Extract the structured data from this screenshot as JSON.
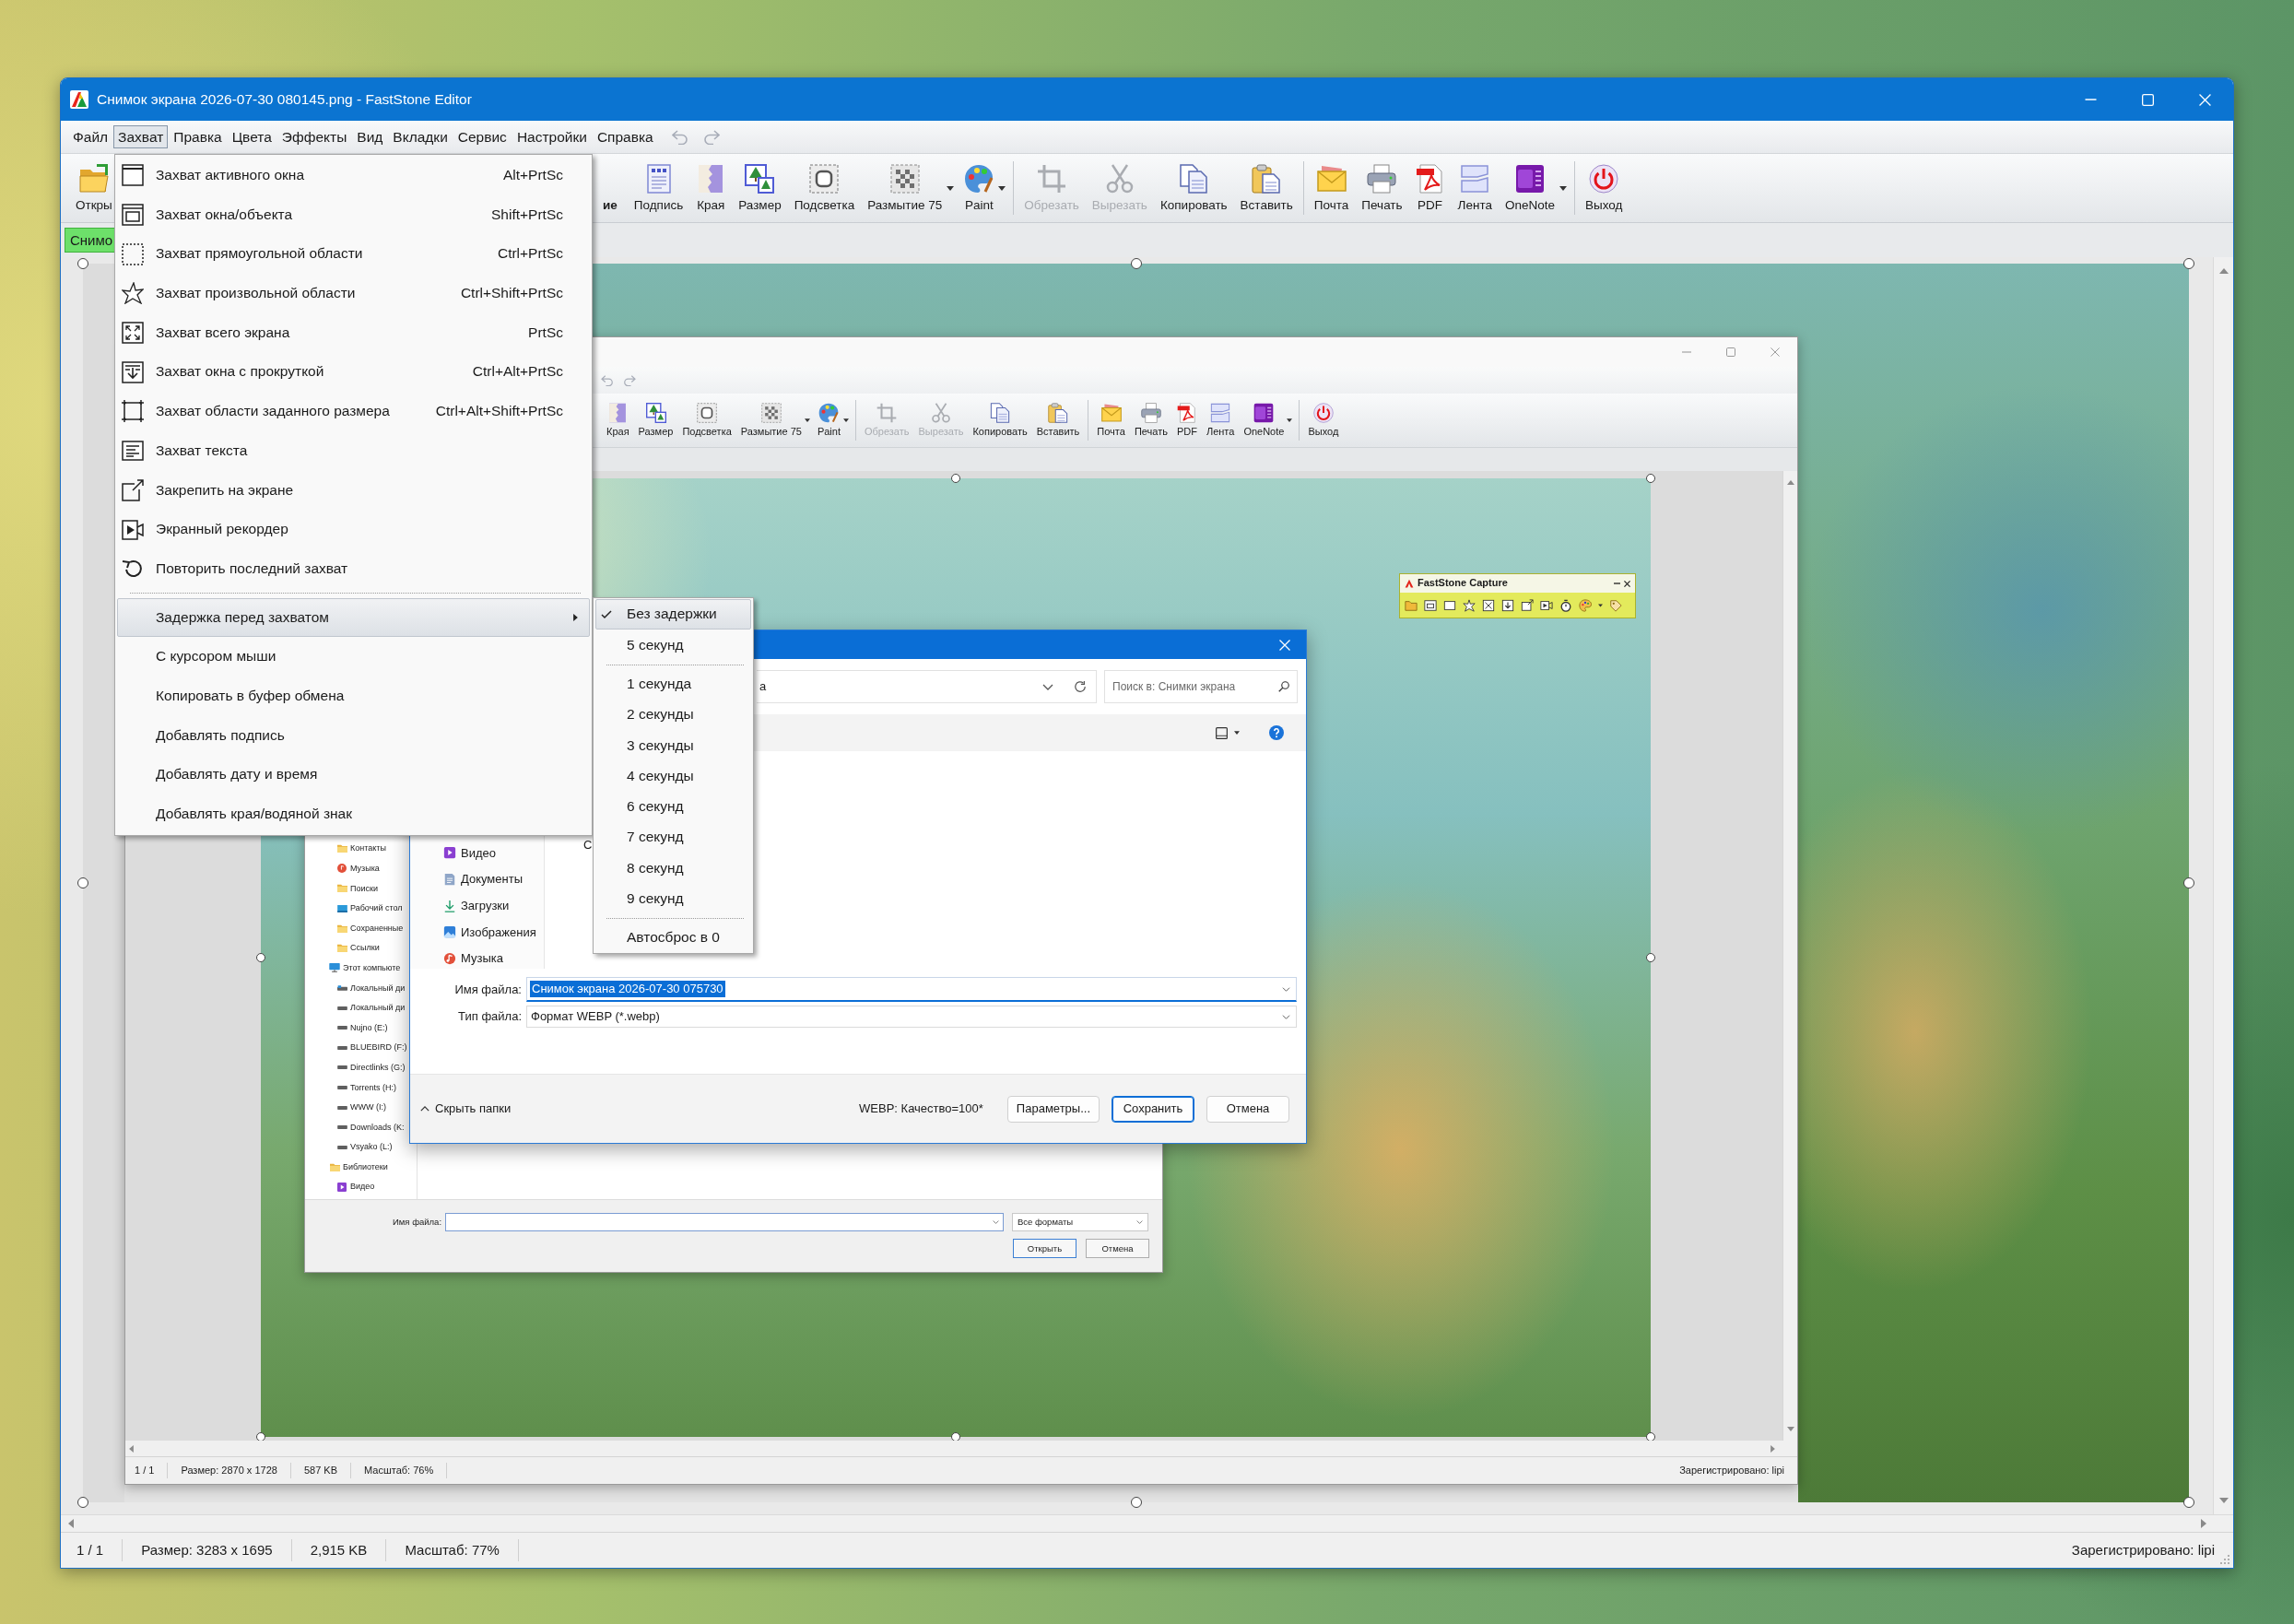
{
  "window": {
    "title": "Снимок экрана 2026-07-30 080145.png - FastStone Editor"
  },
  "menu_bar": [
    {
      "label": "Файл",
      "selected": false
    },
    {
      "label": "Захват",
      "selected": true
    },
    {
      "label": "Правка",
      "selected": false
    },
    {
      "label": "Цвета",
      "selected": false
    },
    {
      "label": "Эффекты",
      "selected": false
    },
    {
      "label": "Вид",
      "selected": false
    },
    {
      "label": "Вкладки",
      "selected": false
    },
    {
      "label": "Сервис",
      "selected": false
    },
    {
      "label": "Настройки",
      "selected": false
    },
    {
      "label": "Справка",
      "selected": false
    }
  ],
  "toolbar": [
    {
      "kind": "button",
      "label": "Откры",
      "disabled": false,
      "dropdown": false
    },
    {
      "kind": "partial",
      "label": "ие",
      "disabled": false,
      "dropdown": false
    },
    {
      "kind": "button",
      "label": "Подпись",
      "disabled": false,
      "dropdown": false
    },
    {
      "kind": "button",
      "label": "Края",
      "disabled": false,
      "dropdown": false
    },
    {
      "kind": "button",
      "label": "Размер",
      "disabled": false,
      "dropdown": false
    },
    {
      "kind": "button",
      "label": "Подсветка",
      "disabled": false,
      "dropdown": false
    },
    {
      "kind": "button",
      "label": "Размытие 75",
      "disabled": false,
      "dropdown": true
    },
    {
      "kind": "button",
      "label": "Paint",
      "disabled": false,
      "dropdown": true
    },
    {
      "kind": "separator"
    },
    {
      "kind": "button",
      "label": "Обрезать",
      "disabled": true,
      "dropdown": false
    },
    {
      "kind": "button",
      "label": "Вырезать",
      "disabled": true,
      "dropdown": false
    },
    {
      "kind": "button",
      "label": "Копировать",
      "disabled": false,
      "dropdown": false
    },
    {
      "kind": "button",
      "label": "Вставить",
      "disabled": false,
      "dropdown": false
    },
    {
      "kind": "separator"
    },
    {
      "kind": "button",
      "label": "Почта",
      "disabled": false,
      "dropdown": false
    },
    {
      "kind": "button",
      "label": "Печать",
      "disabled": false,
      "dropdown": false
    },
    {
      "kind": "button",
      "label": "PDF",
      "disabled": false,
      "dropdown": false
    },
    {
      "kind": "button",
      "label": "Лента",
      "disabled": false,
      "dropdown": false
    },
    {
      "kind": "button",
      "label": "OneNote",
      "disabled": false,
      "dropdown": true
    },
    {
      "kind": "separator"
    },
    {
      "kind": "button",
      "label": "Выход",
      "disabled": false,
      "dropdown": false
    }
  ],
  "tabs": [
    {
      "label": "Снимо",
      "selected": true
    }
  ],
  "capture_menu": [
    {
      "kind": "item",
      "label": "Захват активного окна",
      "shortcut": "Alt+PrtSc",
      "highlighted": false
    },
    {
      "kind": "item",
      "label": "Захват окна/объекта",
      "shortcut": "Shift+PrtSc",
      "highlighted": false
    },
    {
      "kind": "item",
      "label": "Захват прямоугольной области",
      "shortcut": "Ctrl+PrtSc",
      "highlighted": false
    },
    {
      "kind": "item",
      "label": "Захват произвольной области",
      "shortcut": "Ctrl+Shift+PrtSc",
      "highlighted": false
    },
    {
      "kind": "item",
      "label": "Захват всего экрана",
      "shortcut": "PrtSc",
      "highlighted": false
    },
    {
      "kind": "item",
      "label": "Захват окна с прокруткой",
      "shortcut": "Ctrl+Alt+PrtSc",
      "highlighted": false
    },
    {
      "kind": "item",
      "label": "Захват области заданного размера",
      "shortcut": "Ctrl+Alt+Shift+PrtSc",
      "highlighted": false
    },
    {
      "kind": "item",
      "label": "Захват текста",
      "highlighted": false
    },
    {
      "kind": "item",
      "label": "Закрепить на экране",
      "highlighted": false
    },
    {
      "kind": "item",
      "label": "Экранный рекордер",
      "highlighted": false
    },
    {
      "kind": "item",
      "label": "Повторить последний захват",
      "highlighted": false
    },
    {
      "kind": "separator"
    },
    {
      "kind": "submenu",
      "label": "Задержка перед захватом",
      "highlighted": true
    },
    {
      "kind": "item",
      "label": "С курсором мыши",
      "highlighted": false
    },
    {
      "kind": "item",
      "label": "Копировать в буфер обмена",
      "highlighted": false
    },
    {
      "kind": "item",
      "label": "Добавлять подпись",
      "highlighted": false
    },
    {
      "kind": "item",
      "label": "Добавлять дату и время",
      "highlighted": false
    },
    {
      "kind": "item",
      "label": "Добавлять края/водяной знак",
      "highlighted": false
    }
  ],
  "delay_submenu": [
    {
      "kind": "item",
      "label": "Без задержки",
      "checked": true,
      "highlighted": true
    },
    {
      "kind": "item",
      "label": "5 секунд",
      "checked": false,
      "highlighted": false
    },
    {
      "kind": "separator"
    },
    {
      "kind": "item",
      "label": "1 секунда",
      "checked": false,
      "highlighted": false
    },
    {
      "kind": "item",
      "label": "2 секунды",
      "checked": false,
      "highlighted": false
    },
    {
      "kind": "item",
      "label": "3 секунды",
      "checked": false,
      "highlighted": false
    },
    {
      "kind": "item",
      "label": "4 секунды",
      "checked": false,
      "highlighted": false
    },
    {
      "kind": "item",
      "label": "6 секунд",
      "checked": false,
      "highlighted": false
    },
    {
      "kind": "item",
      "label": "7 секунд",
      "checked": false,
      "highlighted": false
    },
    {
      "kind": "item",
      "label": "8 секунд",
      "checked": false,
      "highlighted": false
    },
    {
      "kind": "item",
      "label": "9 секунд",
      "checked": false,
      "highlighted": false
    },
    {
      "kind": "separator"
    },
    {
      "kind": "item",
      "label": "Автосброс в 0",
      "checked": false,
      "highlighted": false
    }
  ],
  "canvas": {
    "inner_window": {
      "toolbar": [
        {
          "kind": "button",
          "label": "Края",
          "disabled": false,
          "dropdown": false
        },
        {
          "kind": "button",
          "label": "Размер",
          "disabled": false,
          "dropdown": false
        },
        {
          "kind": "button",
          "label": "Подсветка",
          "disabled": false,
          "dropdown": false
        },
        {
          "kind": "button",
          "label": "Размытие 75",
          "disabled": false,
          "dropdown": true
        },
        {
          "kind": "button",
          "label": "Paint",
          "disabled": false,
          "dropdown": true
        },
        {
          "kind": "separator"
        },
        {
          "kind": "button",
          "label": "Обрезать",
          "disabled": true,
          "dropdown": false
        },
        {
          "kind": "button",
          "label": "Вырезать",
          "disabled": true,
          "dropdown": false
        },
        {
          "kind": "button",
          "label": "Копировать",
          "disabled": false,
          "dropdown": false
        },
        {
          "kind": "button",
          "label": "Вставить",
          "disabled": false,
          "dropdown": false
        },
        {
          "kind": "separator"
        },
        {
          "kind": "button",
          "label": "Почта",
          "disabled": false,
          "dropdown": false
        },
        {
          "kind": "button",
          "label": "Печать",
          "disabled": false,
          "dropdown": false
        },
        {
          "kind": "button",
          "label": "PDF",
          "disabled": false,
          "dropdown": false
        },
        {
          "kind": "button",
          "label": "Лента",
          "disabled": false,
          "dropdown": false
        },
        {
          "kind": "button",
          "label": "OneNote",
          "disabled": false,
          "dropdown": true
        },
        {
          "kind": "separator"
        },
        {
          "kind": "button",
          "label": "Выход",
          "disabled": false,
          "dropdown": false
        }
      ],
      "capture_toolbar": {
        "title": "FastStone Capture"
      },
      "open_dialog": {
        "tree": [
          {
            "children": [
              {
                "label": "Контакты"
              },
              {
                "label": "Музыка"
              },
              {
                "label": "Поиски"
              },
              {
                "label": "Рабочий стол"
              },
              {
                "label": "Сохраненные"
              },
              {
                "label": "Ссылки"
              }
            ]
          },
          {
            "label": "Этот компьюте",
            "children": [
              {
                "label": "Локальный ди"
              },
              {
                "label": "Локальный ди"
              },
              {
                "label": "Nujno (E:)"
              },
              {
                "label": "BLUEBIRD (F:)"
              },
              {
                "label": "Directlinks (G:)"
              },
              {
                "label": "Torrents (H:)"
              },
              {
                "label": "WWW (I:)"
              },
              {
                "label": "Downloads (K:"
              },
              {
                "label": "Vsyako (L:)"
              }
            ]
          },
          {
            "label": "Библиотеки",
            "children": [
              {
                "label": "Видео"
              }
            ]
          }
        ],
        "file_name": {
          "label": "Имя файла:"
        },
        "file_type": {
          "value": "Все форматы"
        },
        "buttons": [
          {
            "label": "Открыть",
            "default": true
          },
          {
            "label": "Отмена",
            "default": false
          }
        ]
      },
      "save_dialog": {
        "address": "а",
        "search": {
          "placeholder": "Поиск в: Снимки экрана"
        },
        "nav": [
          {
            "label": "Видео"
          },
          {
            "label": "Документы"
          },
          {
            "label": "Загрузки"
          },
          {
            "label": "Изображения"
          },
          {
            "label": "Музыка"
          }
        ],
        "list_fragment": "С",
        "file_name": {
          "label": "Имя файла:",
          "value": "Снимок экрана 2026-07-30 075730",
          "selected": true
        },
        "file_type": {
          "label": "Тип файла:",
          "value": "Формат WEBP (*.webp)"
        },
        "hide_folders": "Скрыть папки",
        "quality": "WEBP: Качество=100*",
        "buttons": [
          {
            "label": "Параметры...",
            "default": false
          },
          {
            "label": "Сохранить",
            "default": true
          },
          {
            "label": "Отмена",
            "default": false
          }
        ]
      },
      "status_bar": {
        "page": "1 / 1",
        "size": "Размер: 2870 x 1728",
        "file_size": "587 KB",
        "zoom": "Масштаб: 76%",
        "registration": "Зарегистрировано: lipi"
      }
    }
  },
  "status_bar": {
    "page": "1 / 1",
    "size": "Размер: 3283 x 1695",
    "file_size": "2,915 KB",
    "zoom": "Масштаб: 77%",
    "registration": "Зарегистрировано: lipi"
  }
}
